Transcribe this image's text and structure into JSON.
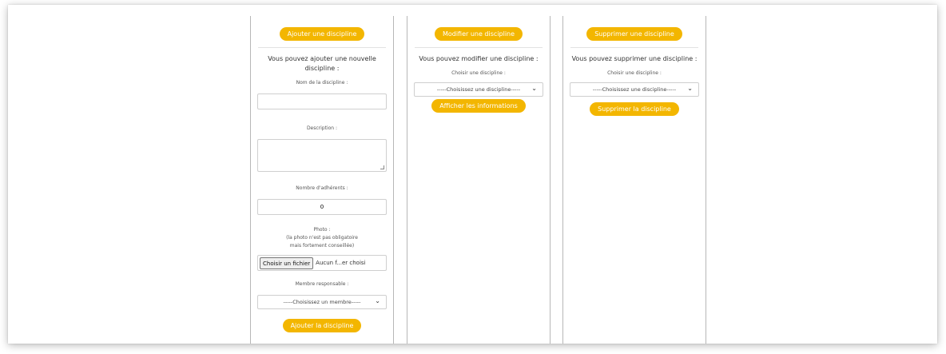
{
  "add": {
    "header_button": "Ajouter une discipline",
    "intro": "Vous pouvez ajouter une nouvelle discipline :",
    "name_label": "Nom de la discipline :",
    "name_value": "",
    "description_label": "Description :",
    "description_value": "",
    "members_label": "Nombre d'adhérents :",
    "members_value": "0",
    "photo_label": "Photo :",
    "photo_note_1": "(la photo n'est pas obligatoire",
    "photo_note_2": "mais fortement conseillée)",
    "file_button": "Choisir un fichier",
    "file_status": "Aucun f...er choisi",
    "responsible_label": "Membre responsable :",
    "responsible_select": "-----Choisissez un membre-----",
    "submit_button": "Ajouter la discipline"
  },
  "modify": {
    "header_button": "Modifier une discipline",
    "intro": "Vous pouvez modifier une discipline :",
    "choose_label": "Choisir une discipline :",
    "select_value": "-----Choisissez une discipline-----",
    "submit_button": "Afficher les informations"
  },
  "delete": {
    "header_button": "Supprimer une discipline",
    "intro": "Vous pouvez supprimer une discipline :",
    "choose_label": "Choisir une discipline :",
    "select_value": "-----Choisissez une discipline-----",
    "submit_button": "Supprimer la discipline"
  },
  "colors": {
    "accent": "#f3b600",
    "border": "#b7b7b7"
  }
}
